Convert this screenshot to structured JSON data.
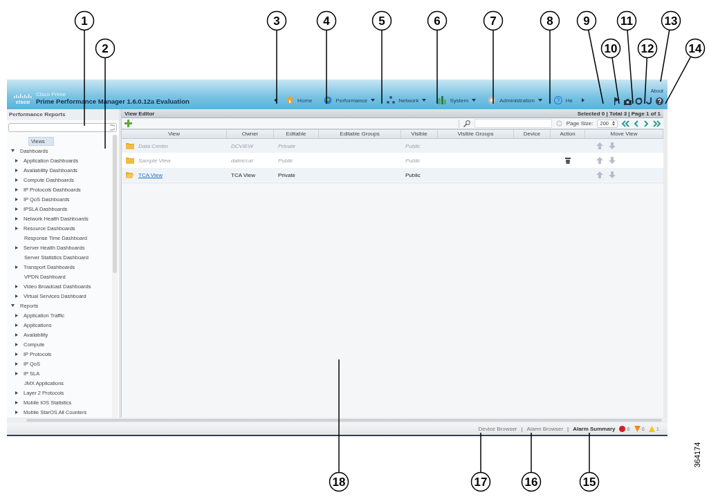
{
  "callouts": [
    {
      "label": "1"
    },
    {
      "label": "2"
    },
    {
      "label": "3"
    },
    {
      "label": "4"
    },
    {
      "label": "5"
    },
    {
      "label": "6"
    },
    {
      "label": "7"
    },
    {
      "label": "8"
    },
    {
      "label": "9"
    },
    {
      "label": "10"
    },
    {
      "label": "11"
    },
    {
      "label": "12"
    },
    {
      "label": "13"
    },
    {
      "label": "14"
    },
    {
      "label": "18"
    },
    {
      "label": "17"
    },
    {
      "label": "16"
    },
    {
      "label": "15"
    }
  ],
  "figure_id": "364174",
  "header": {
    "logo": "cisco",
    "product_line": "Cisco Prime",
    "title": "Prime Performance Manager 1.6.0.12a Evaluation",
    "about_link": "About",
    "nav": [
      {
        "label": "Home",
        "kind": "home",
        "has_menu": false
      },
      {
        "label": "Performance",
        "kind": "globe",
        "has_menu": true
      },
      {
        "label": "Network",
        "kind": "network",
        "has_menu": true
      },
      {
        "label": "System",
        "kind": "system",
        "has_menu": true
      },
      {
        "label": "Administration",
        "kind": "admin",
        "has_menu": true
      },
      {
        "label": "He",
        "kind": "help",
        "has_menu": false
      }
    ]
  },
  "sidebar": {
    "title": "Performance Reports",
    "tree": [
      {
        "label": "Views",
        "selected": true
      },
      {
        "label": "Dashboards",
        "selected": false,
        "expanded": true,
        "children": [
          {
            "label": "Application Dashboards",
            "selected": false,
            "expanded": false
          },
          {
            "label": "Availability Dashboards",
            "selected": false,
            "expanded": false
          },
          {
            "label": "Compute Dashboards",
            "selected": false,
            "expanded": false
          },
          {
            "label": "IP Protocols Dashboards",
            "selected": false,
            "expanded": false
          },
          {
            "label": "IP QoS Dashboards",
            "selected": false,
            "expanded": false
          },
          {
            "label": "IPSLA Dashboards",
            "selected": false,
            "expanded": false
          },
          {
            "label": "Network Health Dashboards",
            "selected": false,
            "expanded": false
          },
          {
            "label": "Resource Dashboards",
            "selected": false,
            "expanded": false
          },
          {
            "label": "Response Time Dashboard",
            "selected": false
          },
          {
            "label": "Server Health Dashboards",
            "selected": false,
            "expanded": false
          },
          {
            "label": "Server Statistics Dashboard",
            "selected": false
          },
          {
            "label": "Transport Dashboards",
            "selected": false,
            "expanded": false
          },
          {
            "label": "VPDN Dashboard",
            "selected": false
          },
          {
            "label": "Video Broadcast Dashboards",
            "selected": false,
            "expanded": false
          },
          {
            "label": "Virtual Services Dashboard",
            "selected": false,
            "expanded": false
          }
        ]
      },
      {
        "label": "Reports",
        "selected": false,
        "expanded": true,
        "children": [
          {
            "label": "Application Traffic",
            "selected": false,
            "expanded": false
          },
          {
            "label": "Applications",
            "selected": false,
            "expanded": false
          },
          {
            "label": "Availability",
            "selected": false,
            "expanded": false
          },
          {
            "label": "Compute",
            "selected": false,
            "expanded": false
          },
          {
            "label": "IP Protocols",
            "selected": false,
            "expanded": false
          },
          {
            "label": "IP QoS",
            "selected": false,
            "expanded": false
          },
          {
            "label": "IP SLA",
            "selected": false,
            "expanded": false
          },
          {
            "label": "JMX Applications",
            "selected": false
          },
          {
            "label": "Layer 2 Protocols",
            "selected": false,
            "expanded": false
          },
          {
            "label": "Mobile IOS Statistics",
            "selected": false,
            "expanded": false
          },
          {
            "label": "Mobile StarOS All Counters",
            "selected": false,
            "expanded": false
          }
        ]
      }
    ]
  },
  "editor": {
    "title": "View Editor",
    "summary": "Selected 0 | Total 3 | Page 1 of 1",
    "page_size_label": "Page Size:",
    "page_size": "200",
    "columns": [
      "View",
      "Owner",
      "Editable",
      "Editable Groups",
      "Visible",
      "Visible Groups",
      "Device",
      "Action",
      "Move View"
    ],
    "rows": [
      {
        "view": "Data Center",
        "owner": "DCVIEW",
        "editable": "Private",
        "visible": "Public",
        "disabled": true,
        "deletable": false,
        "folder_open": false
      },
      {
        "view": "Sample View",
        "owner": "dalmccal",
        "editable": "Public",
        "visible": "Public",
        "disabled": true,
        "deletable": true,
        "folder_open": false
      },
      {
        "view": "TCA View",
        "owner": "TCA View",
        "editable": "Private",
        "visible": "Public",
        "disabled": false,
        "deletable": false,
        "folder_open": true
      }
    ]
  },
  "status_bar": {
    "separator": "|",
    "links": [
      {
        "label": "Device Browser",
        "bold": false
      },
      {
        "label": "Alarm Browser",
        "bold": false
      },
      {
        "label": "Alarm Summary",
        "bold": true
      }
    ],
    "alarms": [
      {
        "kind": "critical",
        "count": "8",
        "color": "#d0202a"
      },
      {
        "kind": "major",
        "count": "6",
        "color": "#f08a1c"
      },
      {
        "kind": "minor",
        "count": "1",
        "color": "#f5c518"
      }
    ]
  }
}
